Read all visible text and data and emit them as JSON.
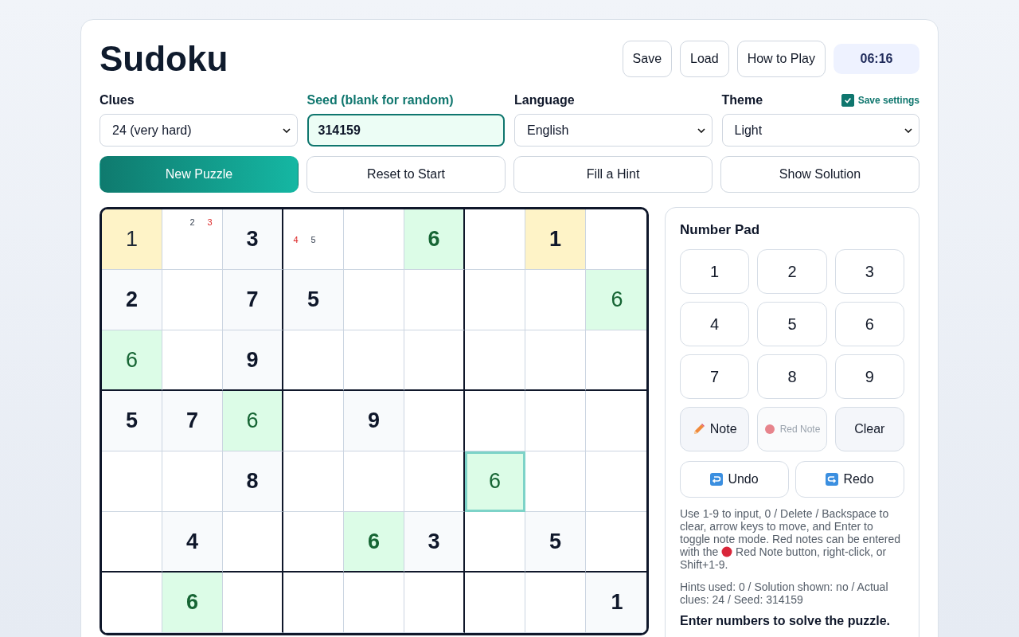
{
  "title": "Sudoku",
  "header_buttons": [
    "Save",
    "Load",
    "How to Play"
  ],
  "timer": "06:16",
  "settings": {
    "clues": {
      "label": "Clues",
      "value": "24 (very hard)"
    },
    "seed": {
      "label": "Seed (blank for random)",
      "value": "314159"
    },
    "language": {
      "label": "Language",
      "value": "English"
    },
    "theme": {
      "label": "Theme",
      "value": "Light"
    },
    "save_settings": {
      "label": "Save settings",
      "checked": true
    }
  },
  "actions": [
    {
      "label": "New Puzzle",
      "primary": true
    },
    {
      "label": "Reset to Start",
      "primary": false
    },
    {
      "label": "Fill a Hint",
      "primary": false
    },
    {
      "label": "Show Solution",
      "primary": false
    }
  ],
  "board": [
    [
      {
        "value": "1",
        "given": false,
        "conflict": true,
        "matching": false,
        "selected": false
      },
      {
        "notes": [
          {
            "digit": "2",
            "red": false
          },
          {
            "digit": "3",
            "red": true
          }
        ],
        "conflict": false,
        "matching": false,
        "selected": false
      },
      {
        "value": "3",
        "given": true,
        "conflict": false,
        "matching": false,
        "selected": false
      },
      {
        "notes": [
          {
            "digit": "4",
            "red": true
          },
          {
            "digit": "5",
            "red": false
          }
        ],
        "conflict": false,
        "matching": false,
        "selected": false
      },
      {
        "conflict": false,
        "matching": false,
        "selected": false
      },
      {
        "value": "6",
        "given": true,
        "conflict": false,
        "matching": true,
        "selected": false
      },
      {
        "conflict": false,
        "matching": false,
        "selected": false
      },
      {
        "value": "1",
        "given": true,
        "conflict": true,
        "matching": false,
        "selected": false
      },
      {
        "conflict": false,
        "matching": false,
        "selected": false
      }
    ],
    [
      {
        "value": "2",
        "given": true,
        "conflict": false,
        "matching": false,
        "selected": false
      },
      {
        "conflict": false,
        "matching": false,
        "selected": false
      },
      {
        "value": "7",
        "given": true,
        "conflict": false,
        "matching": false,
        "selected": false
      },
      {
        "value": "5",
        "given": true,
        "conflict": false,
        "matching": false,
        "selected": false
      },
      {
        "conflict": false,
        "matching": false,
        "selected": false
      },
      {
        "conflict": false,
        "matching": false,
        "selected": false
      },
      {
        "conflict": false,
        "matching": false,
        "selected": false
      },
      {
        "conflict": false,
        "matching": false,
        "selected": false
      },
      {
        "value": "6",
        "given": false,
        "conflict": false,
        "matching": true,
        "selected": false
      }
    ],
    [
      {
        "value": "6",
        "given": false,
        "conflict": false,
        "matching": true,
        "selected": false
      },
      {
        "conflict": false,
        "matching": false,
        "selected": false
      },
      {
        "value": "9",
        "given": true,
        "conflict": false,
        "matching": false,
        "selected": false
      },
      {
        "conflict": false,
        "matching": false,
        "selected": false
      },
      {
        "conflict": false,
        "matching": false,
        "selected": false
      },
      {
        "conflict": false,
        "matching": false,
        "selected": false
      },
      {
        "conflict": false,
        "matching": false,
        "selected": false
      },
      {
        "conflict": false,
        "matching": false,
        "selected": false
      },
      {
        "conflict": false,
        "matching": false,
        "selected": false
      }
    ],
    [
      {
        "value": "5",
        "given": true,
        "conflict": false,
        "matching": false,
        "selected": false
      },
      {
        "value": "7",
        "given": true,
        "conflict": false,
        "matching": false,
        "selected": false
      },
      {
        "value": "6",
        "given": false,
        "conflict": false,
        "matching": true,
        "selected": false
      },
      {
        "conflict": false,
        "matching": false,
        "selected": false
      },
      {
        "value": "9",
        "given": true,
        "conflict": false,
        "matching": false,
        "selected": false
      },
      {
        "conflict": false,
        "matching": false,
        "selected": false
      },
      {
        "conflict": false,
        "matching": false,
        "selected": false
      },
      {
        "conflict": false,
        "matching": false,
        "selected": false
      },
      {
        "conflict": false,
        "matching": false,
        "selected": false
      }
    ],
    [
      {
        "conflict": false,
        "matching": false,
        "selected": false
      },
      {
        "conflict": false,
        "matching": false,
        "selected": false
      },
      {
        "value": "8",
        "given": true,
        "conflict": false,
        "matching": false,
        "selected": false
      },
      {
        "conflict": false,
        "matching": false,
        "selected": false
      },
      {
        "conflict": false,
        "matching": false,
        "selected": false
      },
      {
        "conflict": false,
        "matching": false,
        "selected": false
      },
      {
        "value": "6",
        "given": false,
        "conflict": false,
        "matching": true,
        "selected": true
      },
      {
        "conflict": false,
        "matching": false,
        "selected": false
      },
      {
        "conflict": false,
        "matching": false,
        "selected": false
      }
    ],
    [
      {
        "conflict": false,
        "matching": false,
        "selected": false
      },
      {
        "value": "4",
        "given": true,
        "conflict": false,
        "matching": false,
        "selected": false
      },
      {
        "conflict": false,
        "matching": false,
        "selected": false
      },
      {
        "conflict": false,
        "matching": false,
        "selected": false
      },
      {
        "value": "6",
        "given": true,
        "conflict": false,
        "matching": true,
        "selected": false
      },
      {
        "value": "3",
        "given": true,
        "conflict": false,
        "matching": false,
        "selected": false
      },
      {
        "conflict": false,
        "matching": false,
        "selected": false
      },
      {
        "value": "5",
        "given": true,
        "conflict": false,
        "matching": false,
        "selected": false
      },
      {
        "conflict": false,
        "matching": false,
        "selected": false
      }
    ],
    [
      {
        "conflict": false,
        "matching": false,
        "selected": false
      },
      {
        "value": "6",
        "given": true,
        "conflict": false,
        "matching": true,
        "selected": false
      },
      {
        "conflict": false,
        "matching": false,
        "selected": false
      },
      {
        "conflict": false,
        "matching": false,
        "selected": false
      },
      {
        "conflict": false,
        "matching": false,
        "selected": false
      },
      {
        "conflict": false,
        "matching": false,
        "selected": false
      },
      {
        "conflict": false,
        "matching": false,
        "selected": false
      },
      {
        "conflict": false,
        "matching": false,
        "selected": false
      },
      {
        "value": "1",
        "given": true,
        "conflict": false,
        "matching": false,
        "selected": false
      }
    ]
  ],
  "pad": {
    "title": "Number Pad",
    "keys": [
      {
        "kind": "digit",
        "label": "1",
        "disabled": false
      },
      {
        "kind": "digit",
        "label": "2",
        "disabled": false
      },
      {
        "kind": "digit",
        "label": "3",
        "disabled": false
      },
      {
        "kind": "digit",
        "label": "4",
        "disabled": false
      },
      {
        "kind": "digit",
        "label": "5",
        "disabled": false
      },
      {
        "kind": "digit",
        "label": "6",
        "disabled": false
      },
      {
        "kind": "digit",
        "label": "7",
        "disabled": false
      },
      {
        "kind": "digit",
        "label": "8",
        "disabled": false
      },
      {
        "kind": "digit",
        "label": "9",
        "disabled": false
      },
      {
        "kind": "note",
        "label": "Note",
        "disabled": false
      },
      {
        "kind": "red-note",
        "label": "Red Note",
        "disabled": true
      },
      {
        "kind": "clear",
        "label": "Clear",
        "disabled": false
      }
    ],
    "history": [
      {
        "kind": "undo",
        "label": "Undo"
      },
      {
        "kind": "redo",
        "label": "Redo"
      }
    ],
    "help_before": "Use 1-9 to input, 0 / Delete / Backspace to clear, arrow keys to move, and Enter to toggle note mode. Red notes can be entered with the",
    "help_after": "Red Note button, right-click, or Shift+1-9.",
    "stats": "Hints used: 0 / Solution shown: no / Actual clues: 24 / Seed: 314159",
    "status": "Enter numbers to solve the puzzle."
  }
}
